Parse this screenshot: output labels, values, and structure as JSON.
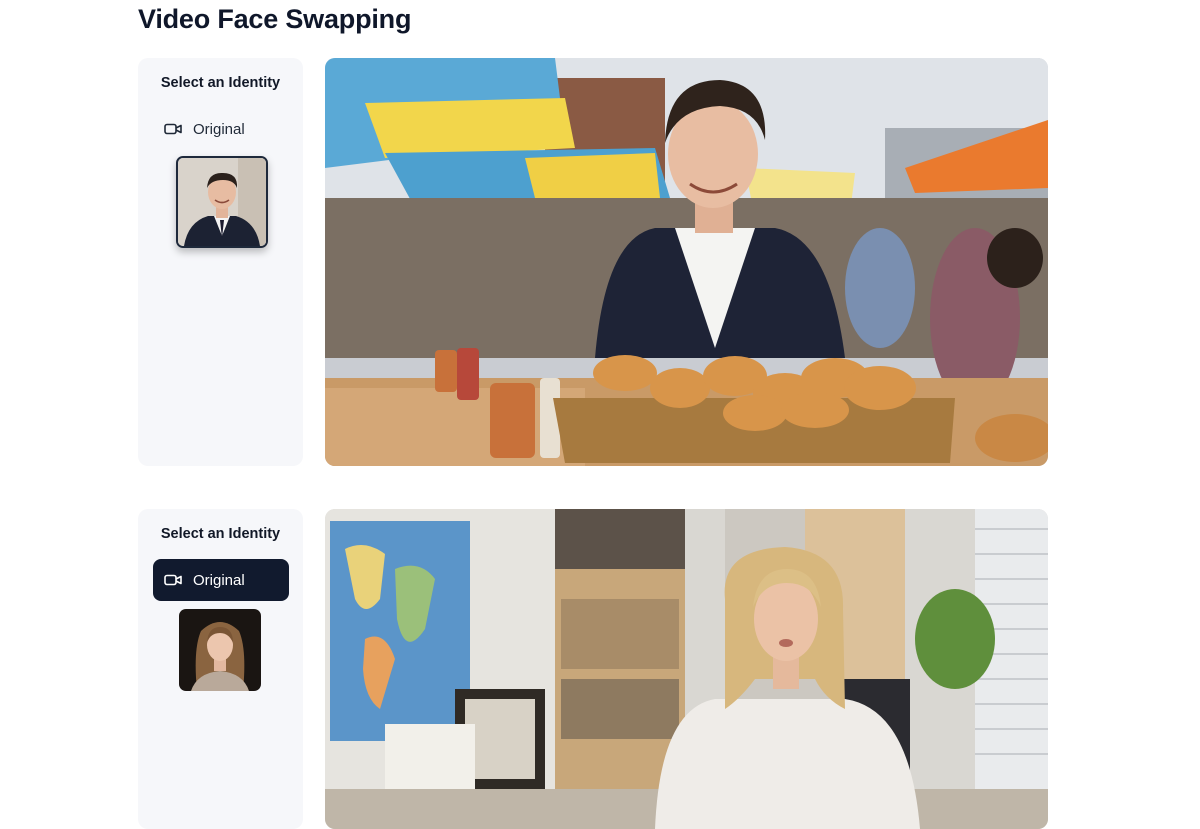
{
  "page": {
    "title": "Video Face Swapping"
  },
  "sections": [
    {
      "sidebar": {
        "title": "Select an Identity",
        "original_label": "Original",
        "original_active": false
      },
      "identity_thumb": {
        "description_icon": "portrait-man"
      },
      "video": {
        "scene": "market-stall"
      }
    },
    {
      "sidebar": {
        "title": "Select an Identity",
        "original_label": "Original",
        "original_active": true
      },
      "identity_thumb": {
        "description_icon": "portrait-woman"
      },
      "video": {
        "scene": "home-office"
      }
    }
  ],
  "colors": {
    "active_button": "#111a2e",
    "sidebar_bg": "#f6f7fa",
    "text": "#0f172a"
  }
}
